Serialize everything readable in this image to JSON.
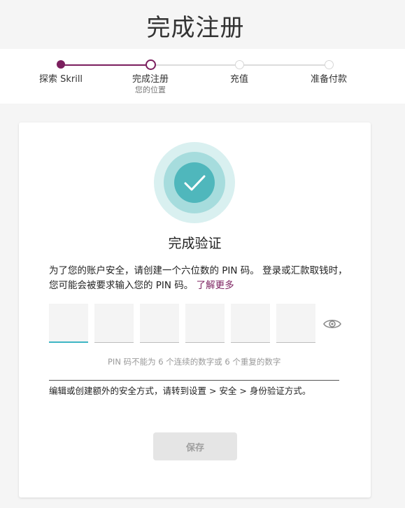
{
  "page_title": "完成注册",
  "steps": [
    {
      "label": "探索 Skrill",
      "sublabel": "",
      "state": "done"
    },
    {
      "label": "完成注册",
      "sublabel": "您的位置",
      "state": "current"
    },
    {
      "label": "充值",
      "sublabel": "",
      "state": "todo"
    },
    {
      "label": "准备付款",
      "sublabel": "",
      "state": "todo"
    }
  ],
  "card": {
    "badge_icon": "check-icon",
    "title": "完成验证",
    "description": "为了您的账户安全，请创建一个六位数的 PIN 码。 登录或汇款取钱时，您可能会被要求输入您的 PIN 码。",
    "learn_more": "了解更多",
    "pin": {
      "digits": [
        "",
        "",
        "",
        "",
        "",
        ""
      ],
      "toggle_icon": "eye-icon",
      "hint": "PIN 码不能为 6 个连续的数字或 6 个重复的数字"
    },
    "note": "编辑或创建额外的安全方式，请转到设置 > 安全 > 身份验证方式。",
    "save_label": "保存"
  },
  "colors": {
    "brand": "#7b1f5e",
    "accent": "#3fb6c4",
    "badge": "#4fb7bc"
  }
}
